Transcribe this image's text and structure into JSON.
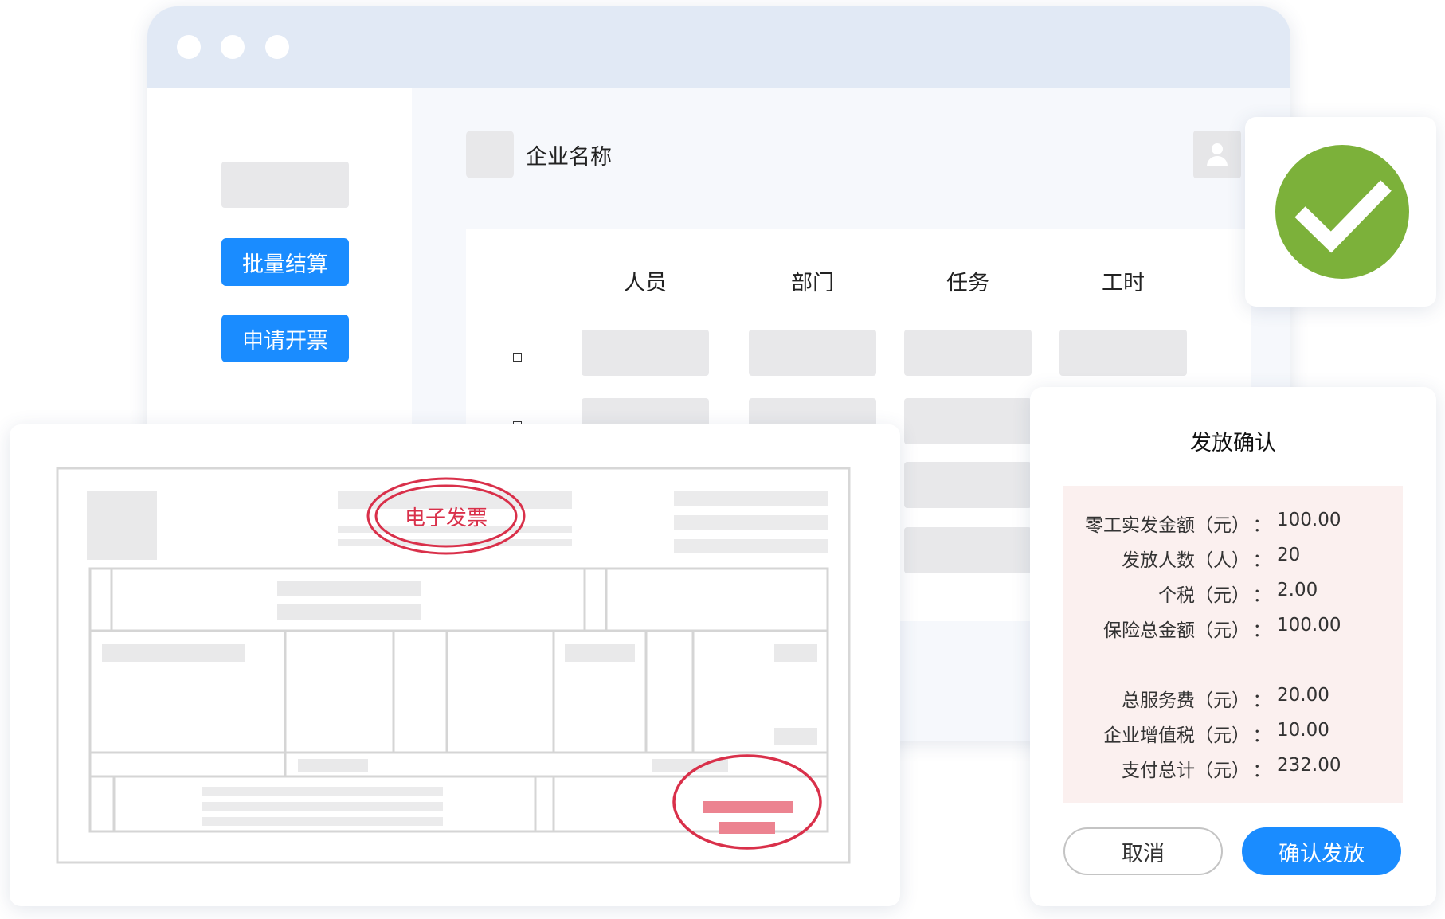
{
  "sidebar": {
    "batch_settle_label": "批量结算",
    "apply_invoice_label": "申请开票"
  },
  "header": {
    "company_name": "企业名称"
  },
  "table": {
    "columns": [
      "人员",
      "部门",
      "任务",
      "工时"
    ]
  },
  "invoice": {
    "stamp_text": "电子发票"
  },
  "dialog": {
    "title": "发放确认",
    "rows": [
      {
        "label": "零工实发金额（元）",
        "value": "100.00"
      },
      {
        "label": "发放人数（人）",
        "value": "20"
      },
      {
        "label": "个税（元）",
        "value": "2.00"
      },
      {
        "label": "保险总金额（元）",
        "value": "100.00"
      },
      {
        "label": "总服务费（元）",
        "value": "20.00"
      },
      {
        "label": "企业增值税（元）",
        "value": "10.00"
      },
      {
        "label": "支付总计（元）",
        "value": "232.00"
      }
    ],
    "separator": "：",
    "cancel_label": "取消",
    "confirm_label": "确认发放"
  },
  "colors": {
    "accent": "#1a8cff",
    "success": "#7cb13a",
    "stamp": "#d9304a"
  },
  "icons": [
    "user-icon",
    "check-icon"
  ]
}
